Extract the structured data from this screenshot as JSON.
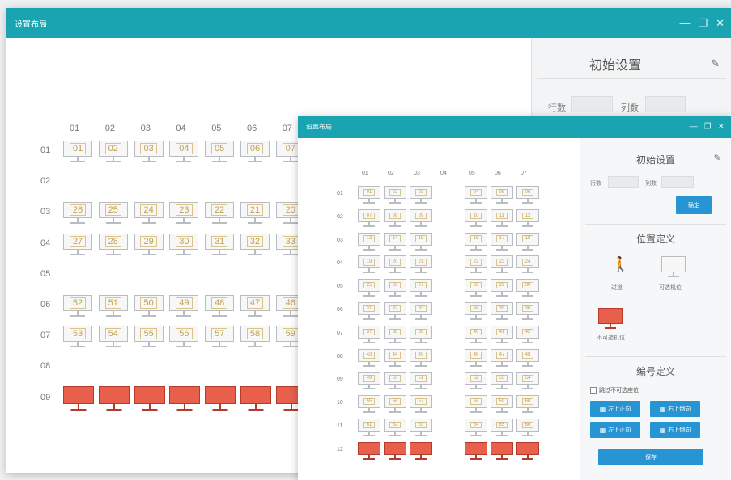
{
  "colors": {
    "titlebar": "#1aa3b0",
    "monitor_normal": "#f7f7f7",
    "monitor_unavailable": "#e8604c",
    "button": "#2795d3"
  },
  "window_back": {
    "title": "设置布局",
    "controls": [
      "minimize-icon",
      "restore-icon",
      "close-icon"
    ],
    "col_headers": [
      "01",
      "02",
      "03",
      "04",
      "05",
      "06",
      "07"
    ],
    "row_headers": [
      "01",
      "02",
      "03",
      "04",
      "05",
      "06",
      "07",
      "08",
      "09"
    ],
    "rows": [
      [
        "01",
        "02",
        "03",
        "04",
        "05",
        "06",
        "07"
      ],
      [],
      [
        "26",
        "25",
        "24",
        "23",
        "22",
        "21",
        "20"
      ],
      [
        "27",
        "28",
        "29",
        "30",
        "31",
        "32",
        "33"
      ],
      [],
      [
        "52",
        "51",
        "50",
        "49",
        "48",
        "47",
        "46"
      ],
      [
        "53",
        "54",
        "55",
        "56",
        "57",
        "58",
        "59"
      ],
      [],
      "red"
    ],
    "panel": {
      "heading": "初始设置",
      "rows_label": "行数",
      "cols_label": "列数"
    }
  },
  "window_front": {
    "title": "设置布局",
    "controls": [
      "minimize-icon",
      "restore-icon",
      "close-icon"
    ],
    "col_headers": [
      "01",
      "02",
      "03",
      "04",
      "05",
      "06",
      "07"
    ],
    "row_headers": [
      "01",
      "02",
      "03",
      "04",
      "05",
      "06",
      "07",
      "08",
      "09",
      "10",
      "11",
      "12"
    ],
    "panel": {
      "initial_heading": "初始设置",
      "rows_label": "行数",
      "cols_label": "列数",
      "confirm_button": "确定",
      "position_heading": "位置定义",
      "aisle_label": "过道",
      "available_label": "可选机位",
      "unavailable_label": "不可选机位",
      "numbering_heading": "编号定义",
      "skip_checkbox_label": "跳过不可选座位",
      "btn_top_left": "左上正向",
      "btn_top_right": "右上倒向",
      "btn_bottom_left": "左下正向",
      "btn_bottom_right": "右下倒向",
      "save_button": "保存"
    }
  }
}
